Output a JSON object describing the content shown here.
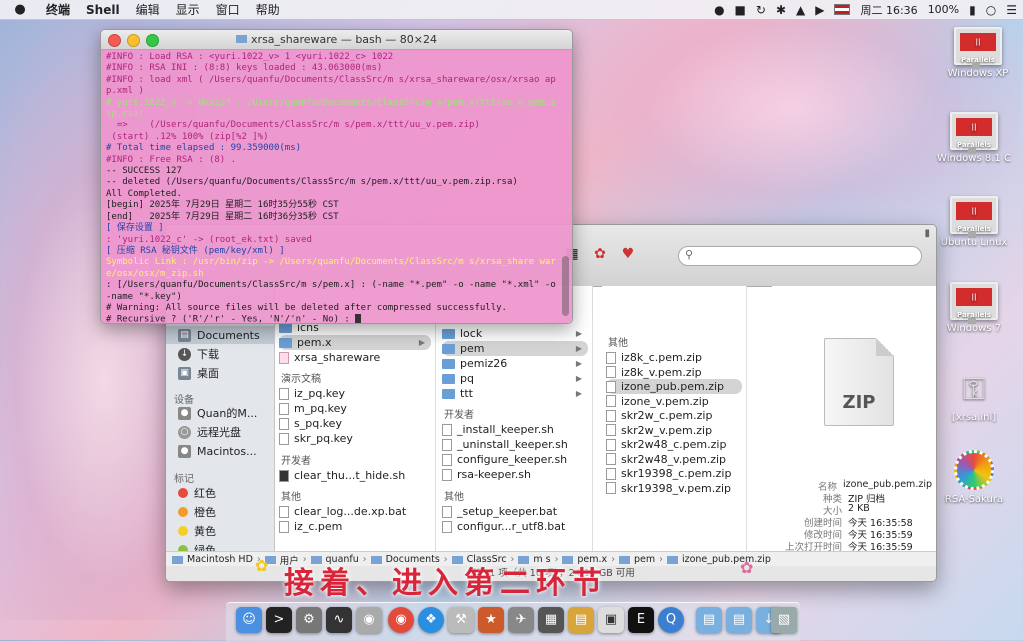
{
  "menubar": {
    "apple": "",
    "items": [
      "终端",
      "Shell",
      "编辑",
      "显示",
      "窗口",
      "帮助"
    ],
    "flag_label": "",
    "clock": "周二 16:36",
    "battery": "100%"
  },
  "terminal": {
    "title": "xrsa_shareware — bash — 80×24",
    "lines": [
      {
        "text": "#INFO : Load RSA : <yuri.1022_v> 1 <yuri.1022_c> 1022",
        "color": "c-mag"
      },
      {
        "text": "#INFO : RSA INI : (8:8) keys loaded : 43.063000(ms)",
        "color": "c-mag"
      },
      {
        "text": "#INFO : load xml ( /Users/quanfu/Documents/ClassSrc/m s/xrsa_shareware/osx/xrsao app.xml )",
        "color": "c-mag"
      },
      {
        "text": "# yuri.1022_v -> Unzip? : /Users/quanfu/Documents/ClassSrc/m s/pem.x/ttt/uu_v.pem.zip.rsa)",
        "color": "c-green"
      },
      {
        "text": "  =>    (/Users/quanfu/Documents/ClassSrc/m s/pem.x/ttt/uu_v.pem.zip)",
        "color": "c-mag"
      },
      {
        "text": " (start) .12% 100% (zip[%2 ]%) ",
        "color": "c-mag"
      },
      {
        "text": "# Total time elapsed : 99.359000(ms)",
        "color": "c-blue"
      },
      {
        "text": "#INFO : Free RSA : (8) .",
        "color": "c-mag"
      },
      {
        "text": "-- SUCCESS 127",
        "color": "c-dark"
      },
      {
        "text": "-- deleted (/Users/quanfu/Documents/ClassSrc/m s/pem.x/ttt/uu_v.pem.zip.rsa)",
        "color": "c-dark"
      },
      {
        "text": "All Completed.",
        "color": "c-dark"
      },
      {
        "text": "[begin] 2025年 7月29日 星期二 16时35分55秒 CST",
        "color": "c-dark"
      },
      {
        "text": "[end]   2025年 7月29日 星期二 16时36分35秒 CST",
        "color": "c-dark"
      },
      {
        "text": "[ 保存设置 ]",
        "color": "c-blue"
      },
      {
        "text": ": 'yuri.1022_c' -> (root_ek.txt) saved",
        "color": "c-mag"
      },
      {
        "text": "[ 压缩 RSA 秘钥文件 (pem/key/xml) ]",
        "color": "c-blue"
      },
      {
        "text": "Symbolic Link : /usr/bin/zip -> /Users/quanfu/Documents/ClassSrc/m s/xrsa_share ware/osx/osx/m_zip.sh",
        "color": "c-yel"
      },
      {
        "text": ": [/Users/quanfu/Documents/ClassSrc/m s/pem.x] : (-name \"*.pem\" -o -name \"*.xml\" -o -name \"*.key\")",
        "color": "c-dark"
      },
      {
        "text": "# Warning: All source files will be deleted after compressed successfully.",
        "color": "c-dark"
      },
      {
        "text": "# Recursive ? ('R'/'r' - Yes, 'N'/'n' - No) : ",
        "color": "c-dark"
      }
    ]
  },
  "finder": {
    "sidebar": {
      "items_top": [
        {
          "label": "Documents",
          "icon": "documents-icon"
        },
        {
          "label": "下载",
          "icon": "downloads-icon"
        },
        {
          "label": "桌面",
          "icon": "desktop-icon"
        }
      ],
      "devices_head": "设备",
      "devices": [
        {
          "label": "Quan的M...",
          "icon": "disk-icon"
        },
        {
          "label": "远程光盘",
          "icon": "disc-icon"
        },
        {
          "label": "Macintos...",
          "icon": "disk-icon"
        }
      ],
      "tags_head": "标记",
      "tags": [
        {
          "label": "红色",
          "color": "#e84a3c"
        },
        {
          "label": "橙色",
          "color": "#f39c2c"
        },
        {
          "label": "黄色",
          "color": "#f2d027"
        },
        {
          "label": "绿色",
          "color": "#8ac43f"
        }
      ]
    },
    "col1": {
      "items": [
        "icns",
        "pem.x",
        "xrsa_shareware"
      ],
      "group1_head": "演示文稿",
      "group1": [
        "iz_pq.key",
        "m_pq.key",
        "s_pq.key",
        "skr_pq.key"
      ],
      "group2_head": "开发者",
      "group2": [
        "clear_thu...t_hide.sh"
      ],
      "group3_head": "其他",
      "group3": [
        "clear_log...de.xp.bat",
        "iz_c.pem"
      ]
    },
    "col2": {
      "items": [
        "lock",
        "pem",
        "pemiz26",
        "pq",
        "ttt"
      ],
      "group1_head": "开发者",
      "group1": [
        "_install_keeper.sh",
        "_uninstall_keeper.sh",
        "configure_keeper.sh",
        "rsa-keeper.sh"
      ],
      "group2_head": "其他",
      "group2": [
        "_setup_keeper.bat",
        "configur...r_utf8.bat"
      ]
    },
    "col3": {
      "head": "其他",
      "items": [
        "iz8k_c.pem.zip",
        "iz8k_v.pem.zip",
        "izone_pub.pem.zip",
        "izone_v.pem.zip",
        "skr2w_c.pem.zip",
        "skr2w_v.pem.zip",
        "skr2w48_c.pem.zip",
        "skr2w48_v.pem.zip",
        "skr19398_c.pem.zip",
        "skr19398_v.pem.zip"
      ],
      "selected_index": 2
    },
    "preview": {
      "zip_label": "ZIP",
      "info": [
        {
          "k": "名称",
          "v": "izone_pub.pem.zip"
        },
        {
          "k": "种类",
          "v": "ZIP 归档"
        },
        {
          "k": "大小",
          "v": "2 KB"
        },
        {
          "k": "创建时间",
          "v": "今天 16:35:58"
        },
        {
          "k": "修改时间",
          "v": "今天 16:35:59"
        },
        {
          "k": "上次打开时间",
          "v": "今天 16:35:59"
        }
      ]
    },
    "path": [
      "Macintosh HD",
      "用户",
      "quanfu",
      "Documents",
      "ClassSrc",
      "m s",
      "pem.x",
      "pem",
      "izone_pub.pem.zip"
    ],
    "status": "择了 1 项（共 10 项），24.16 GB 可用"
  },
  "desktop_icons": [
    {
      "label": "Windows XP",
      "name": "windows-xp-vm-icon"
    },
    {
      "label": "Windows 8.1 C",
      "name": "windows-81-vm-icon"
    },
    {
      "label": "Ubuntu Linux",
      "name": "ubuntu-vm-icon"
    },
    {
      "label": "Windows 7",
      "name": "windows-7-vm-icon"
    },
    {
      "label": "[xrsa.ini]",
      "name": "xrsa-ini-icon"
    },
    {
      "label": "RSA-Sakura",
      "name": "rsa-sakura-icon"
    }
  ],
  "parallels_badge": "|| Parallels",
  "subtitle": "接着、进入第二环节",
  "colors": {
    "terminal_bg": "#ee96cd",
    "subtitle": "#d9253a",
    "selection": "#d4d4d4"
  }
}
